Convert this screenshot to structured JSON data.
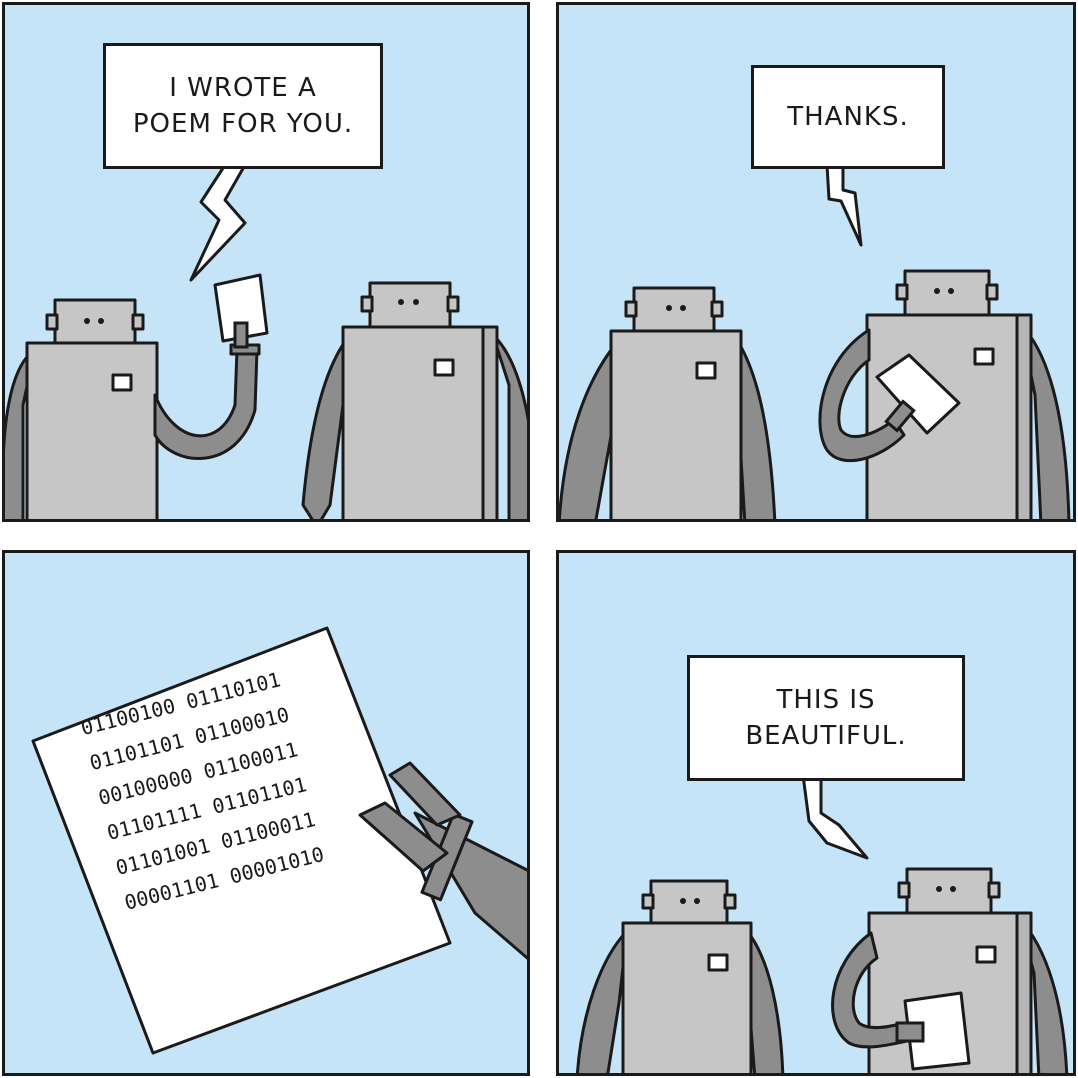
{
  "panels": [
    {
      "speech": "I WROTE A\nPOEM FOR YOU."
    },
    {
      "speech": "THANKS."
    },
    {
      "poem_lines": [
        "01100100 01110101",
        "01101101 01100010",
        "00100000 01100011",
        "01101111 01101101",
        "01101001 01100011",
        "00001101 00001010"
      ]
    },
    {
      "speech": "THIS IS\nBEAUTIFUL."
    }
  ],
  "colors": {
    "sky": "#c5e4f7",
    "robot_body": "#c6c6c6",
    "robot_arm": "#8d8d8d",
    "outline": "#1a1a1a",
    "paper": "#ffffff"
  }
}
